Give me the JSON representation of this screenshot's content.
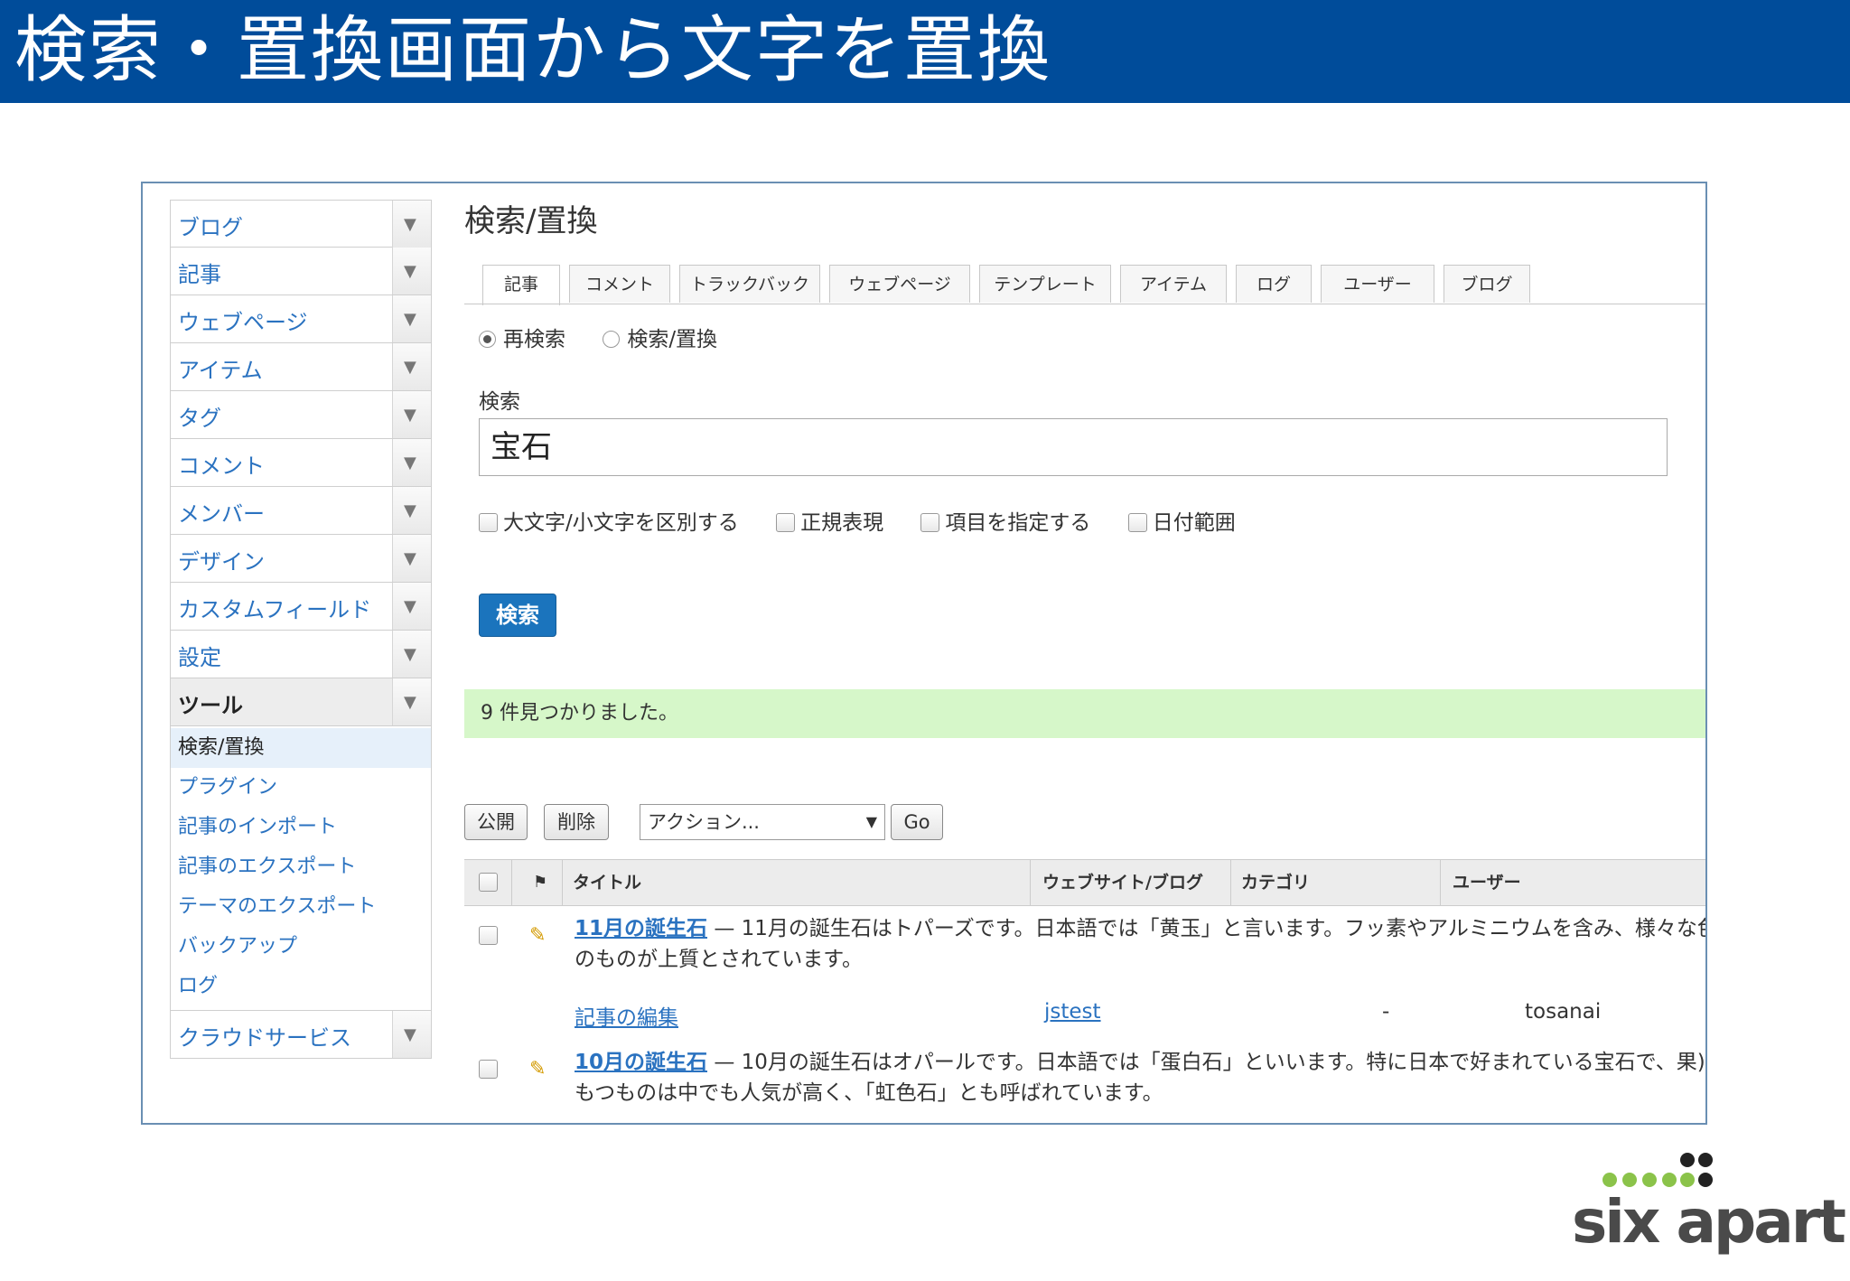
{
  "slide": {
    "title": "検索・置換画面から文字を置換"
  },
  "sidebar": {
    "items": [
      {
        "label": "ブログ"
      },
      {
        "label": "記事"
      },
      {
        "label": "ウェブページ"
      },
      {
        "label": "アイテム"
      },
      {
        "label": "タグ"
      },
      {
        "label": "コメント"
      },
      {
        "label": "メンバー"
      },
      {
        "label": "デザイン"
      },
      {
        "label": "カスタムフィールド"
      },
      {
        "label": "設定"
      },
      {
        "label": "ツール"
      }
    ],
    "subitems": [
      {
        "label": "検索/置換"
      },
      {
        "label": "プラグイン"
      },
      {
        "label": "記事のインポート"
      },
      {
        "label": "記事のエクスポート"
      },
      {
        "label": "テーマのエクスポート"
      },
      {
        "label": "バックアップ"
      },
      {
        "label": "ログ"
      }
    ],
    "last_item": {
      "label": "クラウドサービス"
    },
    "toggle_glyph": "▼"
  },
  "main": {
    "page_title": "検索/置換",
    "tabs": [
      "記事",
      "コメント",
      "トラックバック",
      "ウェブページ",
      "テンプレート",
      "アイテム",
      "ログ",
      "ユーザー",
      "ブログ"
    ],
    "radio": {
      "research": "再検索",
      "replace": "検索/置換"
    },
    "search_label": "検索",
    "search_value": "宝石",
    "options": [
      "大文字/小文字を区別する",
      "正規表現",
      "項目を指定する",
      "日付範囲"
    ],
    "search_button": "検索",
    "result_message": "9 件見つかりました。",
    "actions": {
      "publish": "公開",
      "delete": "削除",
      "select": "アクション...",
      "go": "Go"
    },
    "table": {
      "headers": {
        "title": "タイトル",
        "site": "ウェブサイト/ブログ",
        "category": "カテゴリ",
        "user": "ユーザー"
      },
      "rows": [
        {
          "title": "11月の誕生石",
          "excerpt": " — 11月の誕生石はトパーズです。日本語では「黄玉」と言います。フッ素やアルミニウムを含み、様々な色のものが上質とされています。",
          "edit": "記事の編集",
          "site": "jstest",
          "category": "-",
          "user": "tosanai"
        },
        {
          "title": "10月の誕生石",
          "excerpt": " — 10月の誕生石はオパールです。日本語では「蛋白石」といいます。特に日本で好まれている宝石で、果)をもつものは中でも人気が高く、「虹色石」とも呼ばれています。"
        }
      ]
    }
  },
  "logo": {
    "text": "six apart",
    "dot_colors": [
      "#8bc34a",
      "#222222"
    ]
  }
}
